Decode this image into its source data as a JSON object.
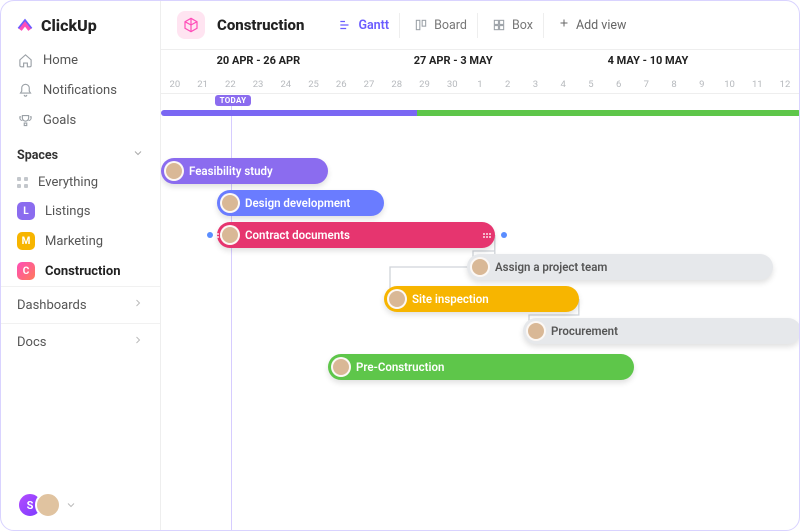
{
  "brand": "ClickUp",
  "nav": {
    "home": "Home",
    "notifications": "Notifications",
    "goals": "Goals"
  },
  "spaces_header": "Spaces",
  "spaces": {
    "everything": "Everything",
    "listings": {
      "badge": "L",
      "label": "Listings"
    },
    "marketing": {
      "badge": "M",
      "label": "Marketing"
    },
    "construction": {
      "badge": "C",
      "label": "Construction"
    }
  },
  "secondary": {
    "dashboards": "Dashboards",
    "docs": "Docs"
  },
  "user_initial": "S",
  "project": {
    "title": "Construction"
  },
  "views": {
    "gantt": "Gantt",
    "board": "Board",
    "box": "Box",
    "add": "Add view"
  },
  "timeline": {
    "weeks": [
      "20 APR - 26 APR",
      "27 APR - 3 MAY",
      "4 MAY - 10 MAY"
    ],
    "days": [
      "20",
      "21",
      "22",
      "23",
      "24",
      "25",
      "26",
      "27",
      "28",
      "29",
      "30",
      "1",
      "2",
      "3",
      "4",
      "5",
      "6",
      "7",
      "8",
      "9",
      "10",
      "11",
      "12"
    ],
    "today_label": "TODAY",
    "today_index": 2
  },
  "tasks": {
    "feasibility": "Feasibility study",
    "design": "Design development",
    "contract": "Contract documents",
    "assign_team": "Assign a project team",
    "inspection": "Site inspection",
    "procurement": "Procurement",
    "precon": "Pre-Construction"
  },
  "chart_data": {
    "type": "gantt",
    "x_unit": "day",
    "x_range": [
      "2020-04-20",
      "2020-05-12"
    ],
    "today": "2020-04-22",
    "week_headers": [
      "20 APR - 26 APR",
      "27 APR - 3 MAY",
      "4 MAY - 10 MAY"
    ],
    "tasks": [
      {
        "name": "Feasibility study",
        "start": "2020-04-20",
        "end": "2020-04-25",
        "color": "#8b6cef"
      },
      {
        "name": "Design development",
        "start": "2020-04-22",
        "end": "2020-04-27",
        "color": "#6a7cff"
      },
      {
        "name": "Contract documents",
        "start": "2020-04-22",
        "end": "2020-05-01",
        "color": "#e6356f",
        "dependency_dots": true
      },
      {
        "name": "Assign a project team",
        "start": "2020-05-01",
        "end": "2020-05-11",
        "color": "#e6e8eb"
      },
      {
        "name": "Site inspection",
        "start": "2020-04-28",
        "end": "2020-05-04",
        "color": "#f7b500"
      },
      {
        "name": "Procurement",
        "start": "2020-05-03",
        "end": "2020-05-12",
        "color": "#e6e8eb"
      },
      {
        "name": "Pre-Construction",
        "start": "2020-04-26",
        "end": "2020-05-06",
        "color": "#5ec64a"
      }
    ],
    "summary_bar": {
      "start": "2020-04-20",
      "end": "2020-05-12",
      "split_at": "2020-04-29",
      "left_color": "#7a67f3",
      "right_color": "#5ec64a"
    },
    "connectors": [
      {
        "from": "Contract documents",
        "to": "Assign a project team"
      },
      {
        "from": "Contract documents",
        "to": "Site inspection"
      },
      {
        "from": "Site inspection",
        "to": "Procurement"
      }
    ]
  }
}
